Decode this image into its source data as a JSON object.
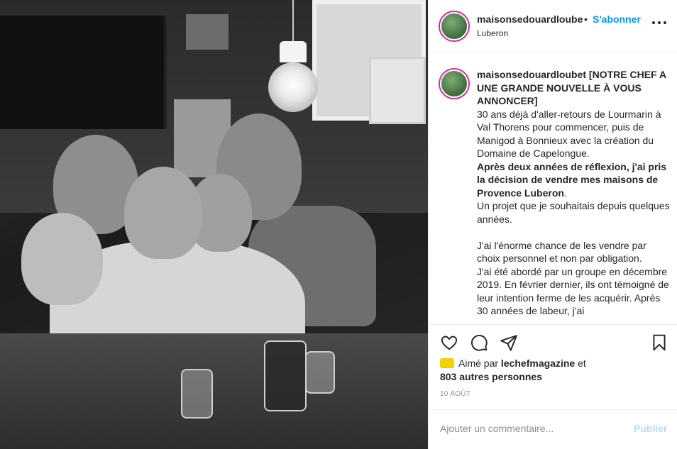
{
  "post": {
    "username": "maisonsedouardloubet",
    "username_truncated": "maisonsedouardloube",
    "follow_label": "S'abonner",
    "dot": "•",
    "location": "Luberon"
  },
  "caption": {
    "user": "maisonsedouardloubet",
    "headline": "[NOTRE CHEF A UNE GRANDE NOUVELLE À VOUS ANNONCER]",
    "p1": "30 ans déjà d'aller-retours de Lourmarin à Val Thorens pour commencer, puis de Manigod à Bonnieux avec la création du Domaine de Capelongue.",
    "p2_bold": "Après deux années de réflexion, j'ai pris la décision de vendre mes maisons de Provence Luberon",
    "p2_end": ".",
    "p3": "Un projet que je souhaitais depuis quelques années.",
    "p4": "J'ai l'énorme chance de les vendre par choix personnel et non par obligation.",
    "p5": "J'ai été abordé par un groupe en décembre 2019. En février dernier, ils ont témoigné de leur intention ferme de les acquérir. Après 30 années de labeur, j'ai"
  },
  "likes": {
    "prefix": "Aimé par",
    "liker": "lechefmagazine",
    "connector": "et",
    "others": "803 autres personnes"
  },
  "date": "10 AOÛT",
  "comment": {
    "placeholder": "Ajouter un commentaire...",
    "publish_label": "Publier"
  },
  "colors": {
    "accent": "#0095f6",
    "publish_disabled": "#b2dffc",
    "text": "#262626",
    "muted": "#8e8e8e"
  },
  "icons": [
    "heart-icon",
    "comment-bubble-icon",
    "paper-plane-icon",
    "bookmark-icon",
    "more-options-icon"
  ]
}
